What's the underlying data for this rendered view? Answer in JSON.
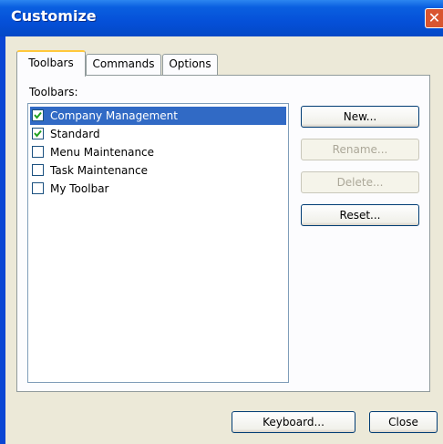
{
  "window": {
    "title": "Customize"
  },
  "tabs": [
    {
      "label": "Toolbars"
    },
    {
      "label": "Commands"
    },
    {
      "label": "Options"
    }
  ],
  "toolbars": {
    "label": "Toolbars:",
    "items": [
      {
        "label": "Company Management",
        "checked": true,
        "selected": true
      },
      {
        "label": "Standard",
        "checked": true,
        "selected": false
      },
      {
        "label": "Menu Maintenance",
        "checked": false,
        "selected": false
      },
      {
        "label": "Task Maintenance",
        "checked": false,
        "selected": false
      },
      {
        "label": "My Toolbar",
        "checked": false,
        "selected": false
      }
    ]
  },
  "buttons": {
    "new": "New...",
    "rename": "Rename...",
    "delete": "Delete...",
    "reset": "Reset...",
    "keyboard": "Keyboard...",
    "close": "Close"
  },
  "colors": {
    "titlebar": "#0550d8",
    "selection": "#316ac5",
    "tab_highlight": "#ffc83c"
  }
}
